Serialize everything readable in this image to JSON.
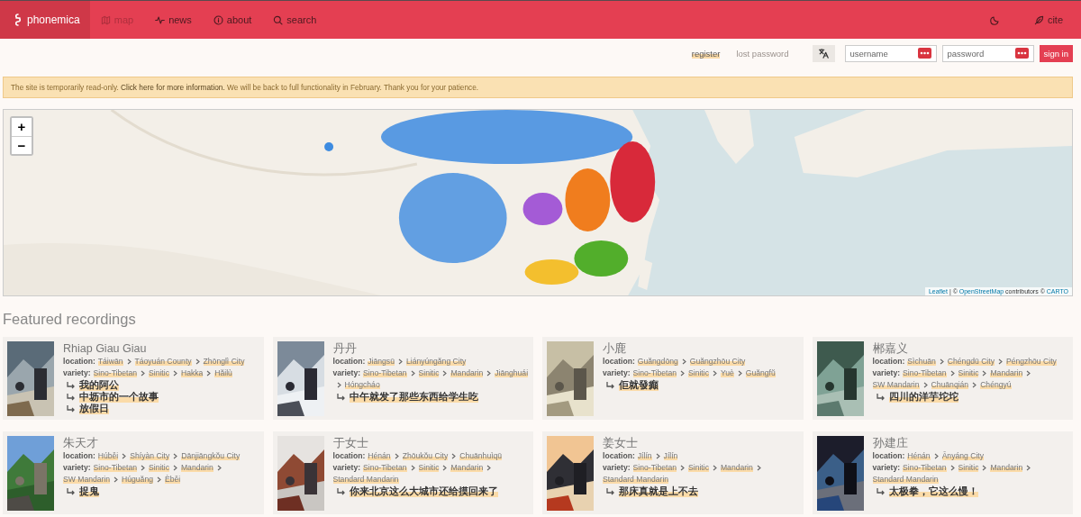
{
  "navbar": {
    "brand": "phonemica",
    "items": [
      {
        "label": "map",
        "disabled": true
      },
      {
        "label": "news",
        "disabled": false
      },
      {
        "label": "about",
        "disabled": false
      },
      {
        "label": "search",
        "disabled": false
      }
    ],
    "cite": "cite"
  },
  "account": {
    "links": [
      {
        "label": "register",
        "disabled": false
      },
      {
        "label": "lost password",
        "disabled": true
      }
    ],
    "username": {
      "placeholder": "username"
    },
    "password": {
      "placeholder": "password"
    },
    "sign_in": "sign in"
  },
  "alert": {
    "before": "The site is temporarily read-only. ",
    "link": "Click here for more information.",
    "after": " We will be back to full functionality in February. Thank you for your patience."
  },
  "map": {
    "zoom_in": "+",
    "zoom_out": "−",
    "attribution": [
      {
        "text": "Leaflet",
        "link": true
      },
      {
        "text": " | © ",
        "link": false
      },
      {
        "text": "OpenStreetMap",
        "link": true
      },
      {
        "text": " contributors © ",
        "link": false
      },
      {
        "text": "CARTO",
        "link": true
      }
    ]
  },
  "featured": {
    "title": "Featured recordings",
    "recordings": [
      {
        "name": "Rhiap Giau Giau",
        "location_label": "location:",
        "location": [
          "Táiwān",
          "Táoyuán County",
          "Zhōnglì City"
        ],
        "variety_label": "variety:",
        "variety": [
          "Sino-Tibetan",
          "Sinitic",
          "Hakka",
          "Hăilù"
        ],
        "titles": [
          "我的阿公",
          "中坜市的一个故事",
          "放假日"
        ]
      },
      {
        "name": "丹丹",
        "location_label": "location:",
        "location": [
          "Jiāngsū",
          "Liányúngăng City"
        ],
        "variety_label": "variety:",
        "variety": [
          "Sino-Tibetan",
          "Sinitic",
          "Mandarin",
          "Jiānghuái",
          "Hóngcháo"
        ],
        "titles": [
          "中午就发了那些东西给学生吃"
        ]
      },
      {
        "name": "小鹿",
        "location_label": "location:",
        "location": [
          "Guăngdōng",
          "Guăngzhōu City"
        ],
        "variety_label": "variety:",
        "variety": [
          "Sino-Tibetan",
          "Sinitic",
          "Yuè",
          "Guăngfŭ"
        ],
        "titles": [
          "佢就發癲"
        ]
      },
      {
        "name": "郴嘉义",
        "location_label": "location:",
        "location": [
          "Sìchuān",
          "Chéngdū City",
          "Péngzhōu City"
        ],
        "variety_label": "variety:",
        "variety": [
          "Sino-Tibetan",
          "Sinitic",
          "Mandarin",
          "SW Mandarin",
          "Chuānqián",
          "Chéngyú"
        ],
        "titles": [
          "四川的洋芋坨坨"
        ]
      },
      {
        "name": "朱天才",
        "location_label": "location:",
        "location": [
          "Húběi",
          "Shíyàn City",
          "Dānjiāngkŏu City"
        ],
        "variety_label": "variety:",
        "variety": [
          "Sino-Tibetan",
          "Sinitic",
          "Mandarin",
          "SW Mandarin",
          "Húguăng",
          "Èběi"
        ],
        "titles": [
          "捉鬼"
        ]
      },
      {
        "name": "于女士",
        "location_label": "location:",
        "location": [
          "Hénán",
          "Zhōukŏu City",
          "Chuānhuìqū"
        ],
        "variety_label": "variety:",
        "variety": [
          "Sino-Tibetan",
          "Sinitic",
          "Mandarin",
          "Standard Mandarin"
        ],
        "titles": [
          "你来北京这么大城市还给摸回来了"
        ]
      },
      {
        "name": "姜女士",
        "location_label": "location:",
        "location": [
          "Jílín",
          "Jílín"
        ],
        "variety_label": "variety:",
        "variety": [
          "Sino-Tibetan",
          "Sinitic",
          "Mandarin",
          "Standard Mandarin"
        ],
        "titles": [
          "那床真就是上不去"
        ]
      },
      {
        "name": "孙建庄",
        "location_label": "location:",
        "location": [
          "Hénán",
          "Ānyáng City"
        ],
        "variety_label": "variety:",
        "variety": [
          "Sino-Tibetan",
          "Sinitic",
          "Mandarin",
          "Standard Mandarin"
        ],
        "titles": [
          "太极拳，它这么慢！"
        ]
      }
    ]
  }
}
